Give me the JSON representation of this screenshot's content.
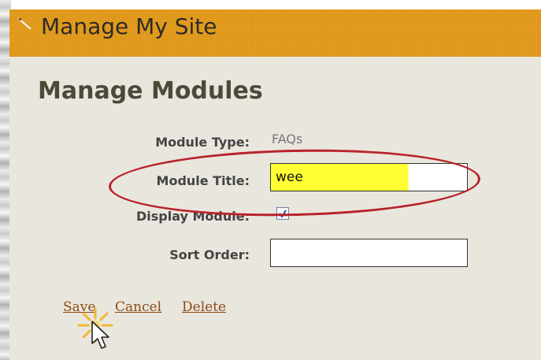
{
  "header": {
    "title": "Manage My Site",
    "icon": "pencil-icon"
  },
  "page": {
    "title": "Manage Modules"
  },
  "form": {
    "module_type": {
      "label": "Module Type:",
      "value": "FAQs"
    },
    "module_title": {
      "label": "Module Title:",
      "value": "wee",
      "highlight_color": "#ffff33"
    },
    "display_module": {
      "label": "Display Module:",
      "checked": true
    },
    "sort_order": {
      "label": "Sort Order:",
      "value": ""
    }
  },
  "actions": {
    "save": "Save",
    "cancel": "Cancel",
    "delete": "Delete"
  },
  "annotation": {
    "ellipse_color": "#b8232b",
    "sparkle_color": "#f2b21f"
  },
  "colors": {
    "header_bg": "#e39a1a",
    "panel_bg": "#e9e6de",
    "link": "#8b4a14"
  }
}
